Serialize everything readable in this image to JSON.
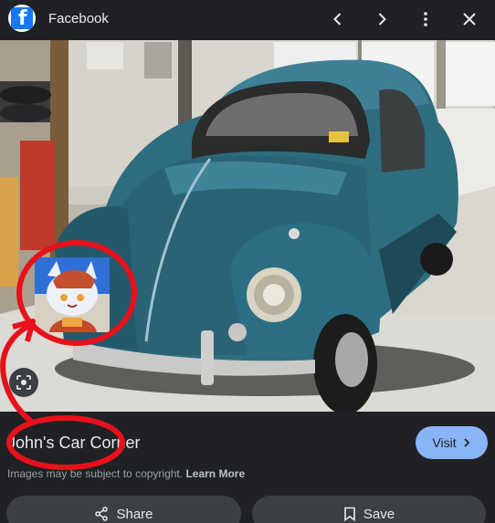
{
  "header": {
    "site_name": "Facebook",
    "logo_letter": "f",
    "icons": [
      "facebook-logo-icon",
      "chevron-left-icon",
      "chevron-right-icon",
      "more-vert-icon",
      "close-icon"
    ]
  },
  "result": {
    "title": "John's Car Corner",
    "visit_label": "Visit",
    "copyright_text": "Images may be subject to copyright.",
    "learn_more_label": "Learn More"
  },
  "actions": {
    "share_label": "Share",
    "save_label": "Save"
  },
  "colors": {
    "background": "#202124",
    "visit_button": "#8ab4f8",
    "action_button": "#3c4043",
    "annotation_red": "#e8101a",
    "car_teal": "#2f6f82"
  }
}
